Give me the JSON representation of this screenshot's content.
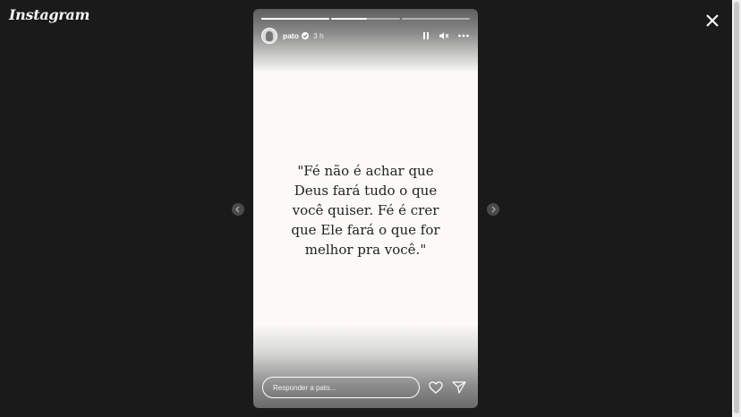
{
  "app": {
    "logo_text": "Instagram"
  },
  "story": {
    "username": "pato",
    "verified": true,
    "time_ago": "3 h",
    "segments": [
      {
        "progress": 1.0
      },
      {
        "progress": 0.52
      },
      {
        "progress": 0.0
      }
    ],
    "quote": "\"Fé não é achar que\nDeus fará tudo o que\nvocê quiser. Fé é crer\nque Ele fará o que for\nmelhor pra você.\"",
    "background": "#fbfaf8",
    "text_color": "#222222"
  },
  "footer": {
    "reply_placeholder": "Responder a pato..."
  },
  "icons": {
    "close": "close-icon",
    "pause": "pause-icon",
    "mute": "volume-muted-icon",
    "more": "more-options-icon",
    "prev": "chevron-left-icon",
    "next": "chevron-right-icon",
    "like": "heart-icon",
    "share": "send-icon"
  },
  "colors": {
    "page_bg": "#1a1a1a"
  }
}
